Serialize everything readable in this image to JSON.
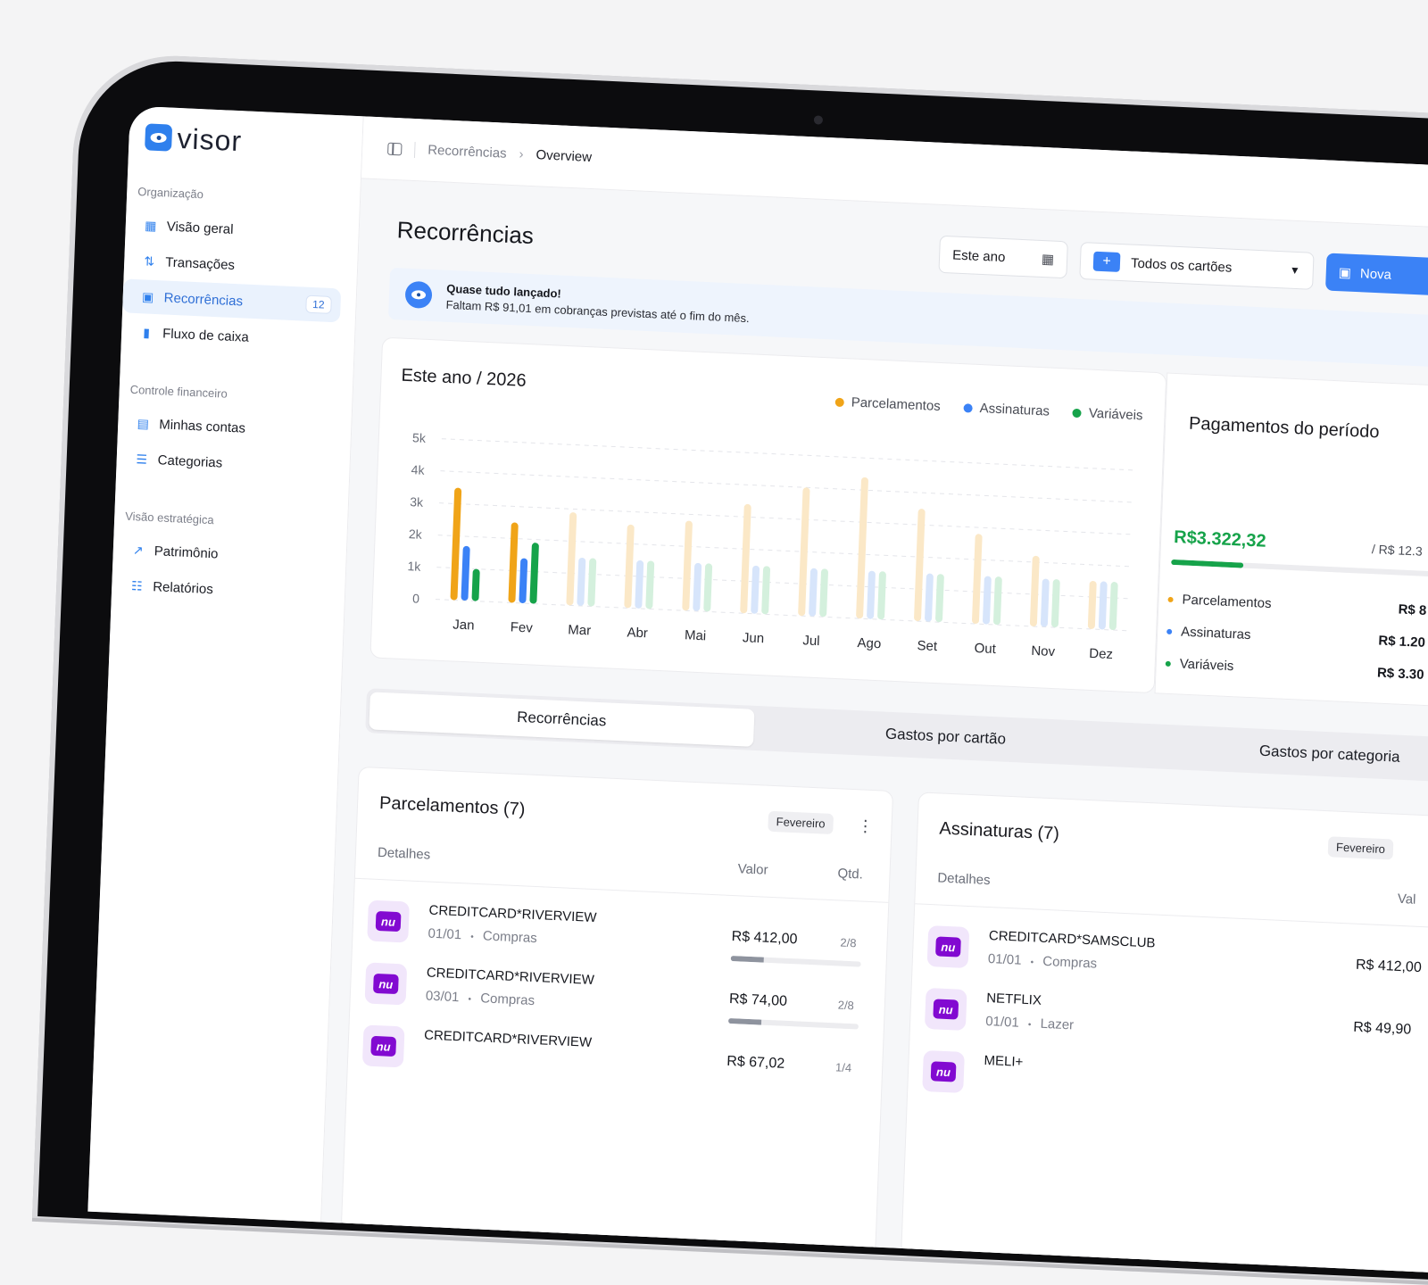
{
  "app": {
    "name": "visor"
  },
  "sidebar": {
    "sections": [
      {
        "title": "Organização",
        "items": [
          {
            "label": "Visão geral",
            "icon": "grid-icon"
          },
          {
            "label": "Transações",
            "icon": "arrows-icon"
          },
          {
            "label": "Recorrências",
            "icon": "calendar-icon",
            "badge": "12",
            "active": true
          },
          {
            "label": "Fluxo de caixa",
            "icon": "bars-icon"
          }
        ]
      },
      {
        "title": "Controle financeiro",
        "items": [
          {
            "label": "Minhas contas",
            "icon": "wallet-icon"
          },
          {
            "label": "Categorias",
            "icon": "list-plus-icon"
          }
        ]
      },
      {
        "title": "Visão estratégica",
        "items": [
          {
            "label": "Patrimônio",
            "icon": "trend-icon"
          },
          {
            "label": "Relatórios",
            "icon": "list-icon"
          }
        ]
      }
    ]
  },
  "breadcrumb": {
    "parent": "Recorrências",
    "current": "Overview",
    "sep": "›"
  },
  "page": {
    "title": "Recorrências"
  },
  "controls": {
    "period": "Este ano",
    "cards": "Todos os cartões",
    "new_button": "Nova",
    "plus": "+"
  },
  "banner": {
    "title": "Quase tudo lançado!",
    "text": "Faltam R$ 91,01 em cobranças previstas até o fim do mês."
  },
  "chart_card": {
    "title": "Este ano / 2026",
    "legend": [
      "Parcelamentos",
      "Assinaturas",
      "Variáveis"
    ]
  },
  "colors": {
    "parcelamentos": "#f0a418",
    "assinaturas": "#3b82f6",
    "variaveis": "#16a34a",
    "accent": "#3b82f6"
  },
  "chart_data": {
    "type": "bar",
    "title": "Este ano / 2026",
    "categories": [
      "Jan",
      "Fev",
      "Mar",
      "Abr",
      "Mai",
      "Jun",
      "Jul",
      "Ago",
      "Set",
      "Out",
      "Nov",
      "Dez"
    ],
    "yticks": [
      "0",
      "1k",
      "2k",
      "3k",
      "4k",
      "5k"
    ],
    "ylim": [
      0,
      5000
    ],
    "series": [
      {
        "name": "Parcelamentos",
        "values": [
          3500,
          2500,
          2900,
          2600,
          2800,
          3400,
          4000,
          4400,
          3500,
          2800,
          2200,
          1500
        ]
      },
      {
        "name": "Assinaturas",
        "values": [
          1700,
          1400,
          1500,
          1500,
          1500,
          1500,
          1500,
          1500,
          1500,
          1500,
          1500,
          1500
        ]
      },
      {
        "name": "Variáveis",
        "values": [
          1000,
          1900,
          1500,
          1500,
          1500,
          1500,
          1500,
          1500,
          1500,
          1500,
          1500,
          1500
        ]
      }
    ],
    "highlight_months": 2,
    "grid": true,
    "legend_position": "top-right"
  },
  "payments": {
    "title": "Pagamentos do período",
    "amount": "R$3.322,32",
    "total": "/ R$ 12.3",
    "progress": 0.27,
    "rows": [
      {
        "label": "Parcelamentos",
        "value": "R$ 8"
      },
      {
        "label": "Assinaturas",
        "value": "R$ 1.20"
      },
      {
        "label": "Variáveis",
        "value": "R$ 3.30"
      }
    ]
  },
  "tabs": [
    "Recorrências",
    "Gastos por cartão",
    "Gastos por categoria"
  ],
  "parcelamentos": {
    "title": "Parcelamentos (7)",
    "month": "Fevereiro",
    "kebab": "⋮",
    "cols": {
      "details": "Detalhes",
      "value": "Valor",
      "qty": "Qtd."
    },
    "rows": [
      {
        "name": "CREDITCARD*RIVERVIEW",
        "date": "01/01",
        "cat": "Compras",
        "value": "R$ 412,00",
        "qty": "2/8",
        "progress": 0.25
      },
      {
        "name": "CREDITCARD*RIVERVIEW",
        "date": "03/01",
        "cat": "Compras",
        "value": "R$ 74,00",
        "qty": "2/8",
        "progress": 0.25
      },
      {
        "name": "CREDITCARD*RIVERVIEW",
        "date": "",
        "cat": "",
        "value": "R$ 67,02",
        "qty": "1/4",
        "progress": 0.25
      }
    ]
  },
  "assinaturas": {
    "title": "Assinaturas (7)",
    "month": "Fevereiro",
    "cols": {
      "details": "Detalhes",
      "value": "Val"
    },
    "rows": [
      {
        "name": "CREDITCARD*SAMSCLUB",
        "date": "01/01",
        "cat": "Compras",
        "value": "R$ 412,00"
      },
      {
        "name": "NETFLIX",
        "date": "01/01",
        "cat": "Lazer",
        "value": "R$ 49,90"
      },
      {
        "name": "MELI+",
        "date": "",
        "cat": "",
        "value": ""
      }
    ]
  },
  "nu_label": "nu",
  "bullet": "•"
}
